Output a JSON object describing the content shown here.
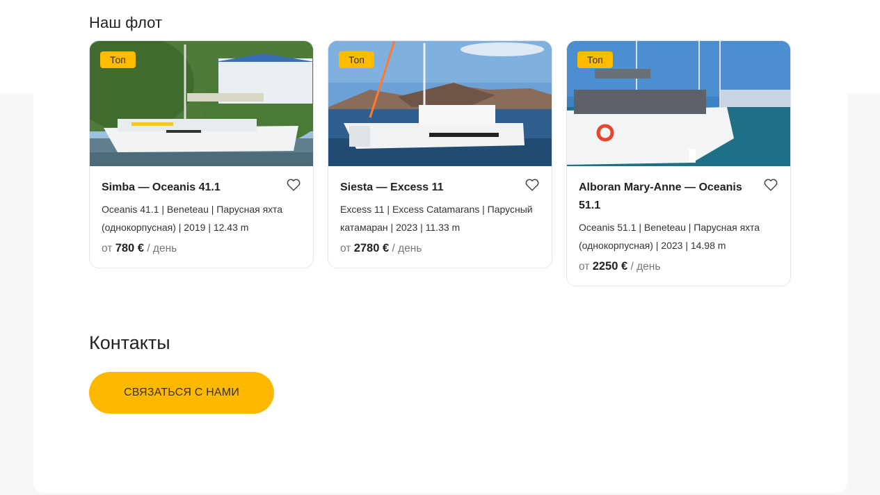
{
  "fleet": {
    "title": "Наш флот",
    "cards": [
      {
        "badge": "Топ",
        "title": "Simba — Oceanis 41.1",
        "specs": "Oceanis 41.1 | Beneteau | Парусная яхта (однокорпусная) | 2019 | 12.43 m",
        "price_prefix": "от",
        "price": "780 €",
        "price_suffix": "/ день"
      },
      {
        "badge": "Топ",
        "title": "Siesta — Excess 11",
        "specs": "Excess 11 | Excess Catamarans | Парусный катамаран | 2023 | 11.33 m",
        "price_prefix": "от",
        "price": "2780 €",
        "price_suffix": "/ день"
      },
      {
        "badge": "Топ",
        "title": "Alboran Mary-Anne — Oceanis 51.1",
        "specs": "Oceanis 51.1 | Beneteau | Парусная яхта (однокорпусная) | 2023 | 14.98 m",
        "price_prefix": "от",
        "price": "2250 €",
        "price_suffix": "/ день"
      }
    ]
  },
  "contacts": {
    "title": "Контакты",
    "button_label": "СВЯЗАТЬСЯ С НАМИ"
  },
  "icons": {
    "favorite": "heart-outline-icon"
  },
  "colors": {
    "accent": "#ffb800",
    "badge": "#ffbb00",
    "text": "#222222",
    "muted": "#777777"
  }
}
